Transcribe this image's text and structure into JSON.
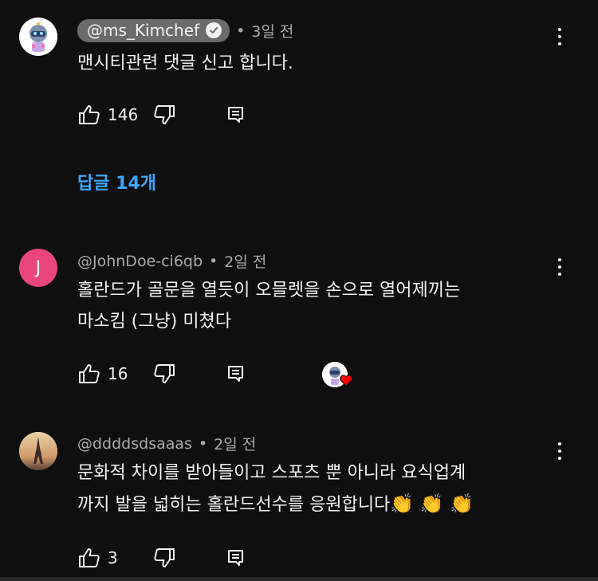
{
  "comments": [
    {
      "author": "@ms_Kimchef",
      "verified": true,
      "time": "3일 전",
      "text": "맨시티관련 댓글 신고 합니다.",
      "likes": "146",
      "replies_label": "답글 14개"
    },
    {
      "author": "@JohnDoe-ci6qb",
      "avatar_letter": "J",
      "time": "2일 전",
      "text_line1": "홀란드가 골문을 열듯이 오믈렛을 손으로 열어제끼는",
      "text_line2": "마소킴 (그냥) 미쳤다",
      "likes": "16"
    },
    {
      "author": "@ddddsdsaaas",
      "time": "2일 전",
      "text_line1": "문화적 차이를 받아들이고 스포츠 뿐 아니라 요식업계",
      "text_line2": "까지 발을 넓히는 홀란드선수를 응원합니다",
      "emojis": "👏 👏 👏",
      "likes": "3"
    }
  ],
  "separator": "•",
  "colors": {
    "background": "#0f0f0f",
    "link": "#3ea6ff",
    "author_chip": "#6b6b6b",
    "avatar_j": "#e8467c",
    "heart": "#ff0000"
  }
}
